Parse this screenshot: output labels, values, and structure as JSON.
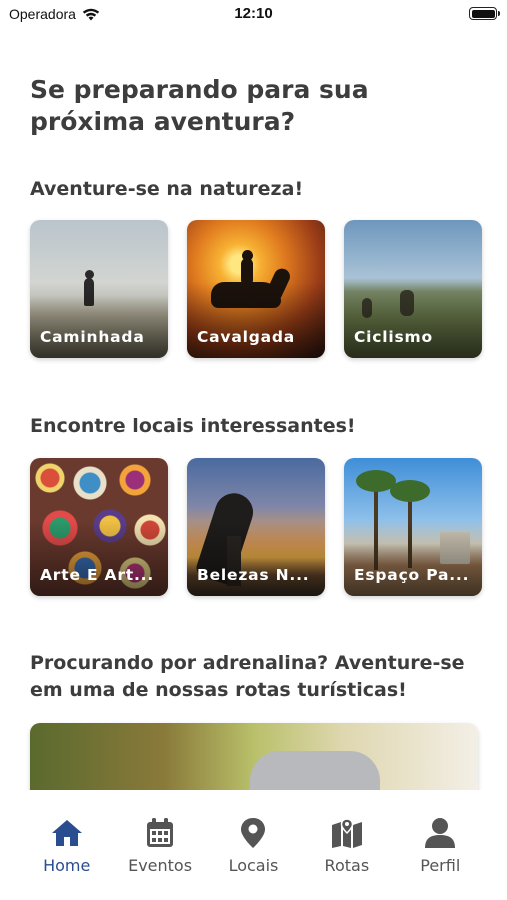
{
  "status_bar": {
    "carrier": "Operadora",
    "time": "12:10"
  },
  "page_title": "Se preparando para sua próxima aventura?",
  "nature": {
    "title": "Aventure-se na natureza!",
    "cards": [
      {
        "label": "Caminhada"
      },
      {
        "label": "Cavalgada"
      },
      {
        "label": "Ciclismo"
      }
    ]
  },
  "places": {
    "title": "Encontre locais interessantes!",
    "cards": [
      {
        "label": "Arte E Art..."
      },
      {
        "label": "Belezas N..."
      },
      {
        "label": "Espaço Pa..."
      }
    ]
  },
  "routes": {
    "title": "Procurando por adrenalina? Aventure-se em uma de nossas rotas turísticas!"
  },
  "tabbar": {
    "active_color": "#2a4d8f",
    "inactive_color": "#555555",
    "tabs": [
      {
        "label": "Home",
        "icon": "home-icon",
        "active": true
      },
      {
        "label": "Eventos",
        "icon": "calendar-icon",
        "active": false
      },
      {
        "label": "Locais",
        "icon": "map-pin-icon",
        "active": false
      },
      {
        "label": "Rotas",
        "icon": "map-icon",
        "active": false
      },
      {
        "label": "Perfil",
        "icon": "user-icon",
        "active": false
      }
    ]
  }
}
